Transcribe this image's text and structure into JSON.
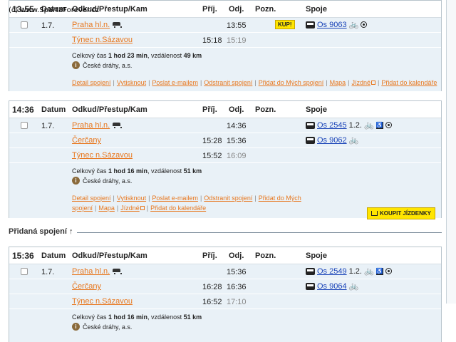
{
  "watermark": "(c) www.SpartaForever.cz",
  "columns": {
    "datum": "Datum",
    "odkud": "Odkud/Přestup/Kam",
    "prij": "Příj.",
    "odj": "Odj.",
    "pozn": "Pozn.",
    "spoje": "Spoje"
  },
  "connections": [
    {
      "time": "13:55",
      "date": "1.7.",
      "rows": [
        {
          "station": "Praha hl.n.",
          "arr": "",
          "dep": "13:55",
          "train": "Os 9063",
          "class": ""
        },
        {
          "station": "Týnec n.Sázavou",
          "arr": "15:18",
          "dep": "15:19",
          "train": "",
          "class": ""
        }
      ],
      "summary_prefix": "Celkový čas",
      "total_time": "1 hod 23 min",
      "summary_mid": ", vzdálenost",
      "distance": "49 km",
      "operator": "České dráhy, a.s.",
      "buy_label": "KUP!",
      "actions": [
        "Detail spojení",
        "Vytisknout",
        "Poslat e-mailem",
        "Odstranit spojení",
        "Přidat do Mých spojení",
        "Mapa",
        "Jízdné",
        "Přidat do kalendáře"
      ]
    },
    {
      "time": "14:36",
      "date": "1.7.",
      "rows": [
        {
          "station": "Praha hl.n.",
          "arr": "",
          "dep": "14:36",
          "train": "Os 2545",
          "class": "1.2."
        },
        {
          "station": "Čerčany",
          "arr": "15:28",
          "dep": "15:36",
          "train": "Os 9062",
          "class": ""
        },
        {
          "station": "Týnec n.Sázavou",
          "arr": "15:52",
          "dep": "16:09",
          "train": "",
          "class": ""
        }
      ],
      "summary_prefix": "Celkový čas",
      "total_time": "1 hod 16 min",
      "summary_mid": ", vzdálenost",
      "distance": "51 km",
      "operator": "České dráhy, a.s.",
      "buy_label": "KOUPIT JÍZDENKY",
      "actions": [
        "Detail spojení",
        "Vytisknout",
        "Poslat e-mailem",
        "Odstranit spojení",
        "Přidat do Mých spojení",
        "Mapa",
        "Jízdné",
        "Přidat do kalendáře"
      ]
    },
    {
      "time": "15:36",
      "date": "1.7.",
      "rows": [
        {
          "station": "Praha hl.n.",
          "arr": "",
          "dep": "15:36",
          "train": "Os 2549",
          "class": "1.2."
        },
        {
          "station": "Čerčany",
          "arr": "16:28",
          "dep": "16:36",
          "train": "Os 9064",
          "class": ""
        },
        {
          "station": "Týnec n.Sázavou",
          "arr": "16:52",
          "dep": "17:10",
          "train": "",
          "class": ""
        }
      ],
      "summary_prefix": "Celkový čas",
      "total_time": "1 hod 16 min",
      "summary_mid": ", vzdálenost",
      "distance": "51 km",
      "operator": "České dráhy, a.s."
    }
  ],
  "added_section_label": "Přidaná spojení ↑"
}
